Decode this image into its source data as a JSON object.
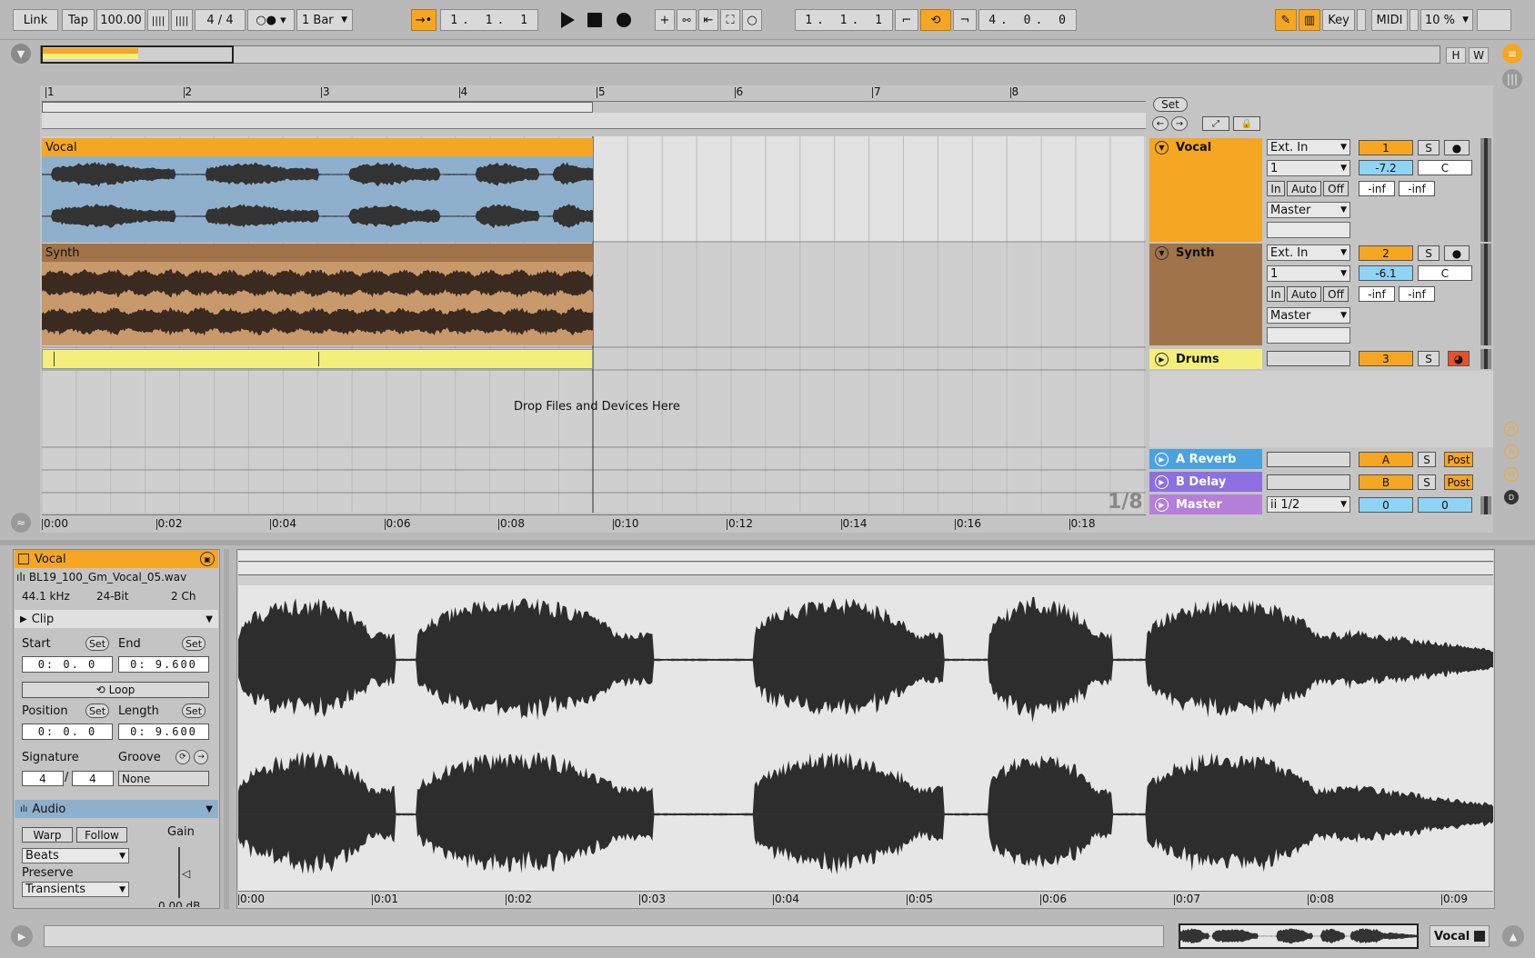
{
  "transport": {
    "link": "Link",
    "tap": "Tap",
    "tempo": "100.00",
    "signature": "4 / 4",
    "quantize": "1 Bar",
    "position": "1. 1. 1",
    "loop_start": "1. 1. 1",
    "loop_length": "4. 0. 0",
    "key": "Key",
    "midi": "MIDI",
    "cpu": "10 %",
    "hw_h": "H",
    "hw_w": "W"
  },
  "arrangement": {
    "bar_labels": [
      "1",
      "2",
      "3",
      "4",
      "5",
      "6",
      "7",
      "8"
    ],
    "time_labels": [
      "0:00",
      "0:02",
      "0:04",
      "0:06",
      "0:08",
      "0:10",
      "0:12",
      "0:14",
      "0:16",
      "0:18"
    ],
    "drop_text": "Drop Files and Devices Here",
    "zoom": "1/8",
    "set_label": "Set",
    "clips": {
      "vocal": "Vocal",
      "synth": "Synth"
    }
  },
  "tracks": [
    {
      "name": "Vocal",
      "color": "#f5a623",
      "input": "Ext. In",
      "channel": "1",
      "monitor": [
        "In",
        "Auto",
        "Off"
      ],
      "output": "Master",
      "number": "1",
      "volume": "-7.2",
      "pan": "C",
      "peak_l": "-inf",
      "peak_r": "-inf",
      "solo": "S"
    },
    {
      "name": "Synth",
      "color": "#a0734a",
      "input": "Ext. In",
      "channel": "1",
      "monitor": [
        "In",
        "Auto",
        "Off"
      ],
      "output": "Master",
      "number": "2",
      "volume": "-6.1",
      "pan": "C",
      "peak_l": "-inf",
      "peak_r": "-inf",
      "solo": "S"
    },
    {
      "name": "Drums",
      "color": "#f4ef7c",
      "number": "3",
      "solo": "S"
    }
  ],
  "returns": [
    {
      "name": "A Reverb",
      "color": "#4aa3df",
      "letter": "A",
      "solo": "S",
      "post": "Post"
    },
    {
      "name": "B Delay",
      "color": "#8c6fe0",
      "letter": "B",
      "solo": "S",
      "post": "Post"
    }
  ],
  "master": {
    "name": "Master",
    "color": "#b57ed8",
    "cue": "ii 1/2",
    "vol_l": "0",
    "vol_r": "0"
  },
  "clip_view": {
    "clip_name": "Vocal",
    "file_name": "BL19_100_Gm_Vocal_05.wav",
    "sample_rate": "44.1 kHz",
    "bit_depth": "24-Bit",
    "channels": "2 Ch",
    "clip_section": "Clip",
    "start_label": "Start",
    "end_label": "End",
    "set": "Set",
    "start_value": "0: 0. 0",
    "end_value": "0: 9.600",
    "loop": "Loop",
    "position_label": "Position",
    "length_label": "Length",
    "position_value": "0: 0. 0",
    "length_value": "0: 9.600",
    "signature_label": "Signature",
    "sig_num": "4",
    "sig_den": "4",
    "groove_label": "Groove",
    "groove_value": "None",
    "audio_section": "Audio",
    "warp": "Warp",
    "follow": "Follow",
    "warp_mode": "Beats",
    "preserve_label": "Preserve",
    "preserve_value": "Transients",
    "gain_label": "Gain",
    "gain_value": "0.00 dB",
    "time_labels": [
      "0:00",
      "0:01",
      "0:02",
      "0:03",
      "0:04",
      "0:05",
      "0:06",
      "0:07",
      "0:08",
      "0:09"
    ]
  },
  "status": {
    "track_name": "Vocal"
  }
}
